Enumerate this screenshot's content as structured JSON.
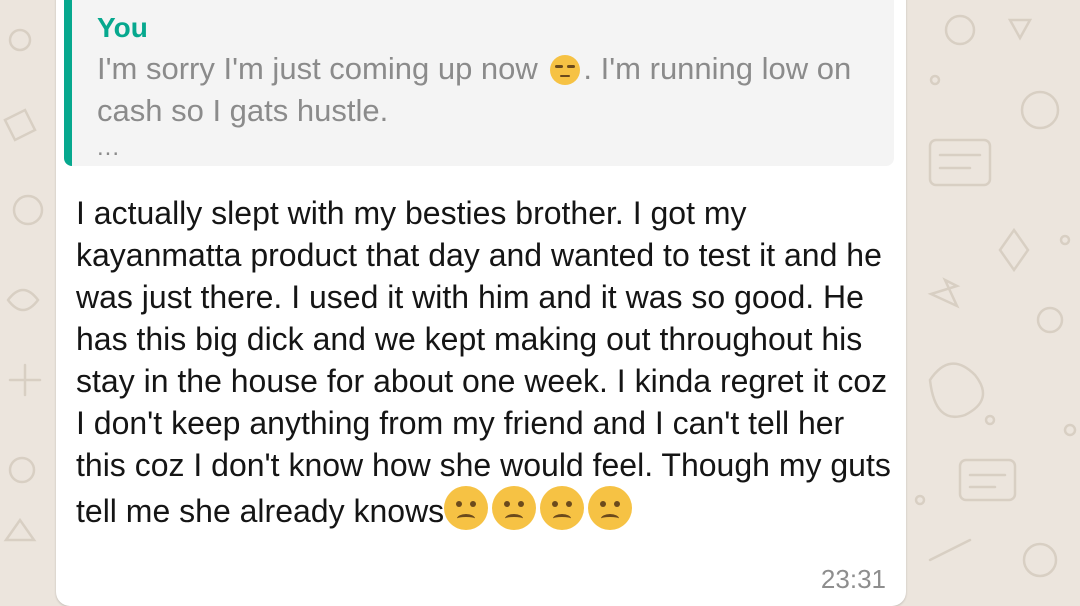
{
  "chat": {
    "background_color": "#ece5dd",
    "bubble_color": "#ffffff",
    "quoted_message": {
      "author": "You",
      "accent_color": "#06a88e",
      "text_before_emoji": "I'm sorry I'm just coming up now",
      "emoji": "pensive-face",
      "text_after_emoji": ". I'm running low on cash so I gats hustle.",
      "ellipsis": "..."
    },
    "message": {
      "text": "I actually slept with my besties brother. I got my kayanmatta product that day and wanted to test it and he was just there. I used it with him and it was so good. He has this big dick and we kept making out throughout his stay in the house for about one week. I kinda regret it coz I don't keep anything from my friend and I can't tell her this coz I don't know how she would feel. Though my guts tell me she already knows",
      "trailing_emojis": [
        "slightly-frowning-face",
        "slightly-frowning-face",
        "slightly-frowning-face",
        "slightly-frowning-face"
      ],
      "time": "23:31"
    }
  }
}
